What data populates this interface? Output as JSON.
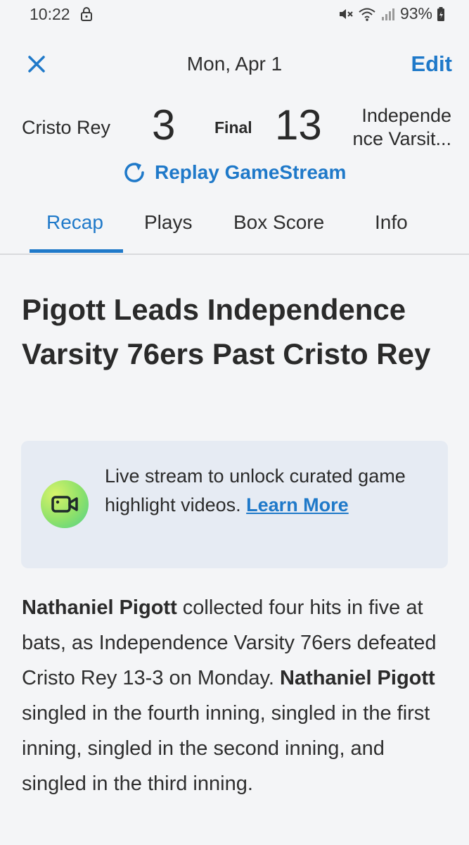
{
  "status_bar": {
    "time": "10:22",
    "battery": "93%",
    "icons": [
      "lock-icon",
      "mute-icon",
      "wifi-icon",
      "signal-icon",
      "battery-icon"
    ]
  },
  "header": {
    "date": "Mon, Apr 1",
    "edit_label": "Edit",
    "close_icon": "close-icon"
  },
  "scoreboard": {
    "home_team": "Cristo Rey",
    "home_score": "3",
    "status": "Final",
    "away_score": "13",
    "away_team_line1": "Independe",
    "away_team_line2": "nce Varsit..."
  },
  "replay": {
    "label": "Replay GameStream",
    "icon": "replay-icon"
  },
  "tabs": [
    {
      "label": "Recap",
      "active": true
    },
    {
      "label": "Plays",
      "active": false
    },
    {
      "label": "Box Score",
      "active": false
    },
    {
      "label": "Info",
      "active": false
    }
  ],
  "article": {
    "title": "Pigott Leads Independence Varsity 76ers Past Cristo Rey",
    "promo": {
      "text": "Live stream to unlock curated game highlight videos.",
      "link_label": "Learn More",
      "icon": "video-camera-icon"
    },
    "body": {
      "player_1": "Nathaniel Pigott",
      "text_1": " collected four hits in five at bats, as Independence Varsity 76ers defeated Cristo Rey 13-3 on Monday. ",
      "player_2": "Nathaniel Pigott",
      "text_2": " singled in the fourth inning, singled in the first inning, singled in the second inning, and singled in the third inning."
    }
  },
  "colors": {
    "accent": "#1f79c9",
    "background": "#f4f5f7",
    "promo_background": "#e6ebf3"
  }
}
